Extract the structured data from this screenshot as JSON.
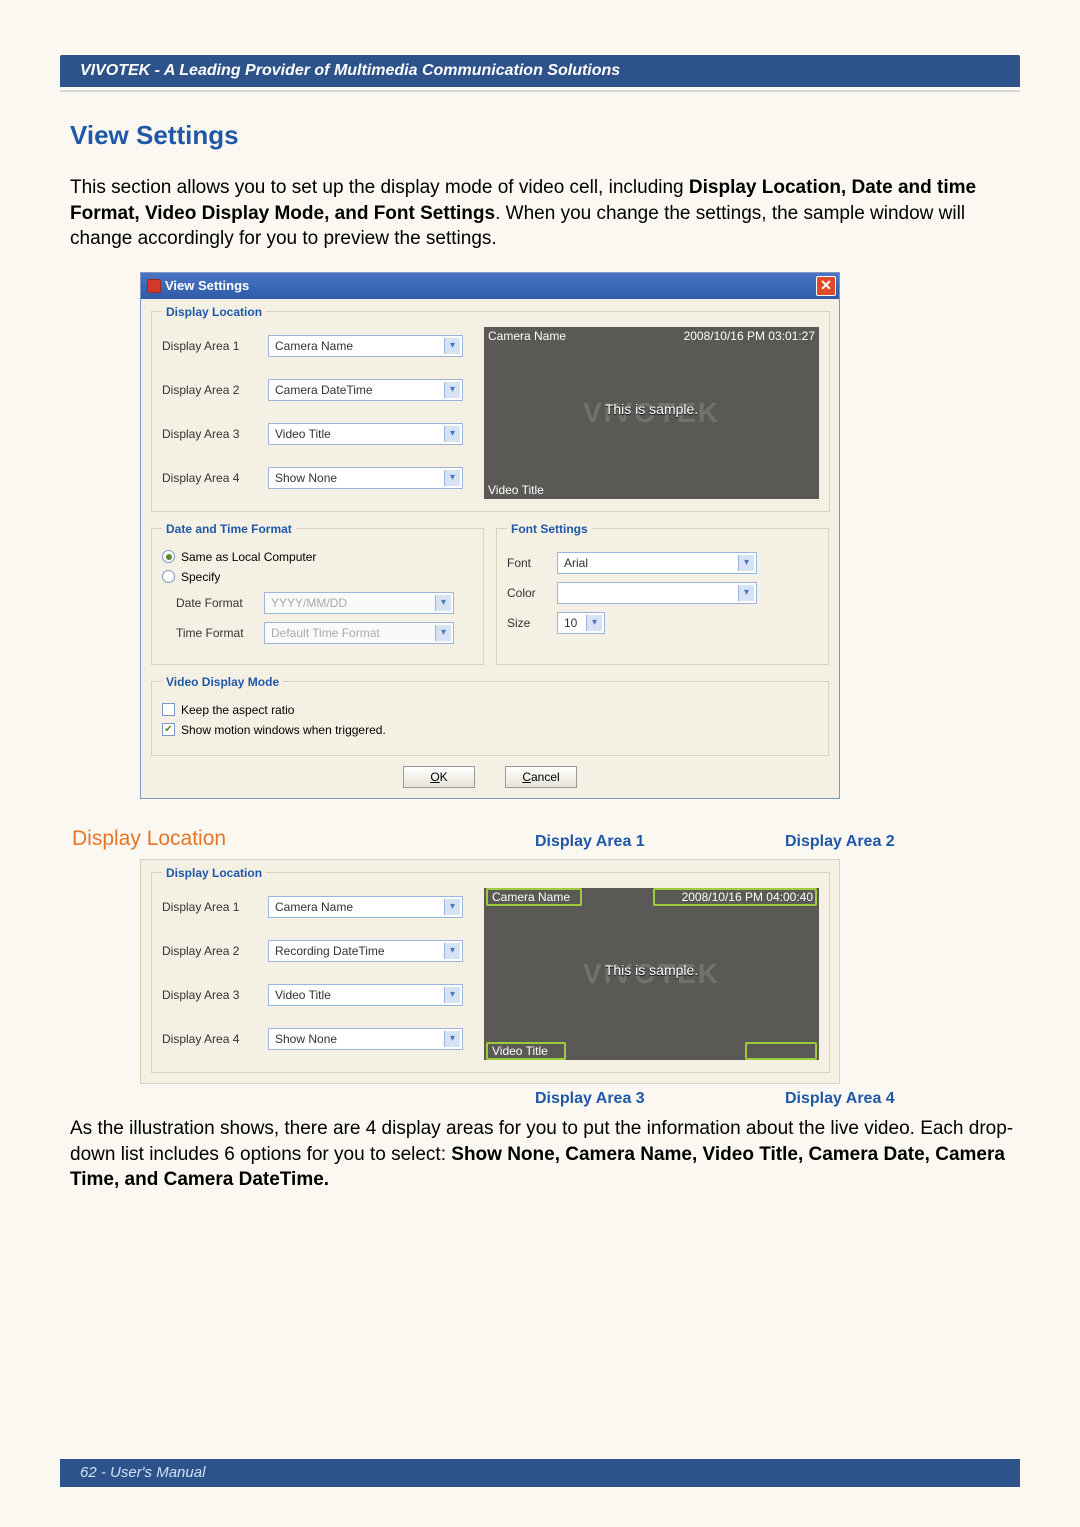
{
  "header": "VIVOTEK - A Leading Provider of Multimedia Communication Solutions",
  "title": "View Settings",
  "intro_before": "This section allows you to set up the display mode of video cell, including ",
  "intro_bold": "Display Location, Date and time Format, Video Display Mode, and Font Settings",
  "intro_after": ". When you change the settings, the sample window will change accordingly for you to preview the settings.",
  "dialog": {
    "title": "View Settings",
    "display_location_legend": "Display Location",
    "areas": [
      {
        "label": "Display Area 1",
        "value": "Camera Name"
      },
      {
        "label": "Display Area 2",
        "value": "Camera DateTime"
      },
      {
        "label": "Display Area 3",
        "value": "Video Title"
      },
      {
        "label": "Display Area 4",
        "value": "Show None"
      }
    ],
    "preview": {
      "cam_name": "Camera Name",
      "cam_time": "2008/10/16 PM 03:01:27",
      "sample": "This is sample.",
      "watermark": "VIVOTEK",
      "video_title": "Video Title"
    },
    "dtf": {
      "legend": "Date and Time Format",
      "same": "Same as Local Computer",
      "specify": "Specify",
      "date_format_lbl": "Date Format",
      "date_format_val": "YYYY/MM/DD",
      "time_format_lbl": "Time Format",
      "time_format_val": "Default Time Format"
    },
    "font": {
      "legend": "Font Settings",
      "font_lbl": "Font",
      "font_val": "Arial",
      "color_lbl": "Color",
      "color_val": "",
      "size_lbl": "Size",
      "size_val": "10"
    },
    "vdm": {
      "legend": "Video Display Mode",
      "keep": "Keep the aspect ratio",
      "motion": "Show motion windows when triggered."
    },
    "ok": "OK",
    "cancel": "Cancel"
  },
  "section2": {
    "heading": "Display Location",
    "area1_lbl": "Display Area 1",
    "area2_lbl": "Display Area 2",
    "area3_lbl": "Display Area 3",
    "area4_lbl": "Display Area 4",
    "legend": "Display Location",
    "areas": [
      {
        "label": "Display Area 1",
        "value": "Camera Name"
      },
      {
        "label": "Display Area 2",
        "value": "Recording DateTime"
      },
      {
        "label": "Display Area 3",
        "value": "Video Title"
      },
      {
        "label": "Display Area 4",
        "value": "Show None"
      }
    ],
    "preview": {
      "cam_name": "Camera Name",
      "cam_time": "2008/10/16 PM 04:00:40",
      "sample": "This is sample.",
      "watermark": "VIVOTEK",
      "video_title": "Video Title"
    }
  },
  "illustration_before": "As the illustration shows, there are 4 display areas for you to put the information about the live video. Each drop-down list includes 6 options for you to select: ",
  "illustration_bold": "Show None, Camera Name, Video Title, Camera Date, Camera Time, and Camera DateTime.",
  "footer": "62 - User's Manual"
}
